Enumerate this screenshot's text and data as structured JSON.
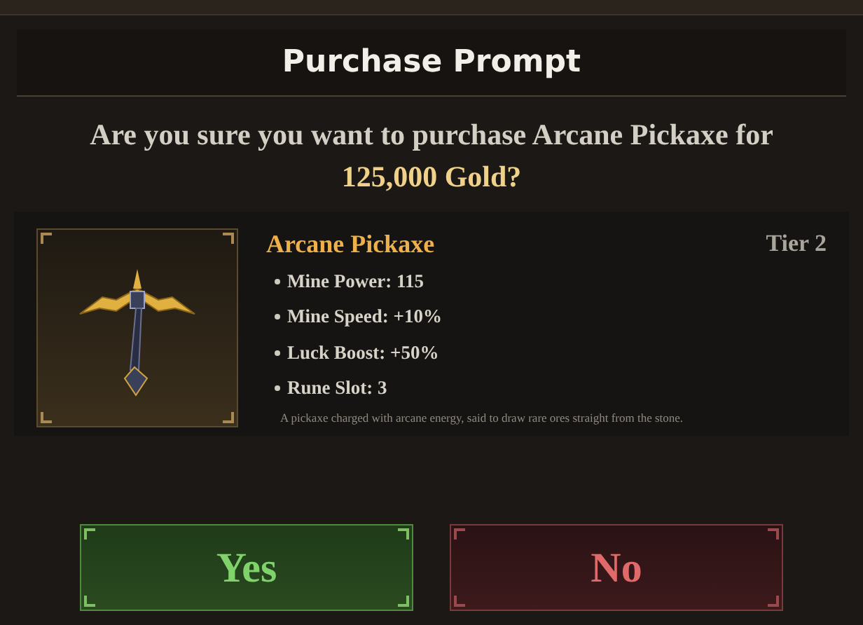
{
  "dialog": {
    "title": "Purchase Prompt",
    "question": "Are you sure you want to purchase Arcane Pickaxe for",
    "price": "125,000 Gold?"
  },
  "item": {
    "name": "Arcane Pickaxe",
    "tier": "Tier 2",
    "stats": [
      "Mine Power: 115",
      "Mine Speed: +10%",
      "Luck Boost: +50%",
      "Rune Slot: 3"
    ],
    "description": "A pickaxe charged with arcane energy, said to draw rare ores straight from the stone."
  },
  "buttons": [
    {
      "label": "Yes",
      "kind": "confirm"
    },
    {
      "label": "No",
      "kind": "cancel"
    }
  ]
}
